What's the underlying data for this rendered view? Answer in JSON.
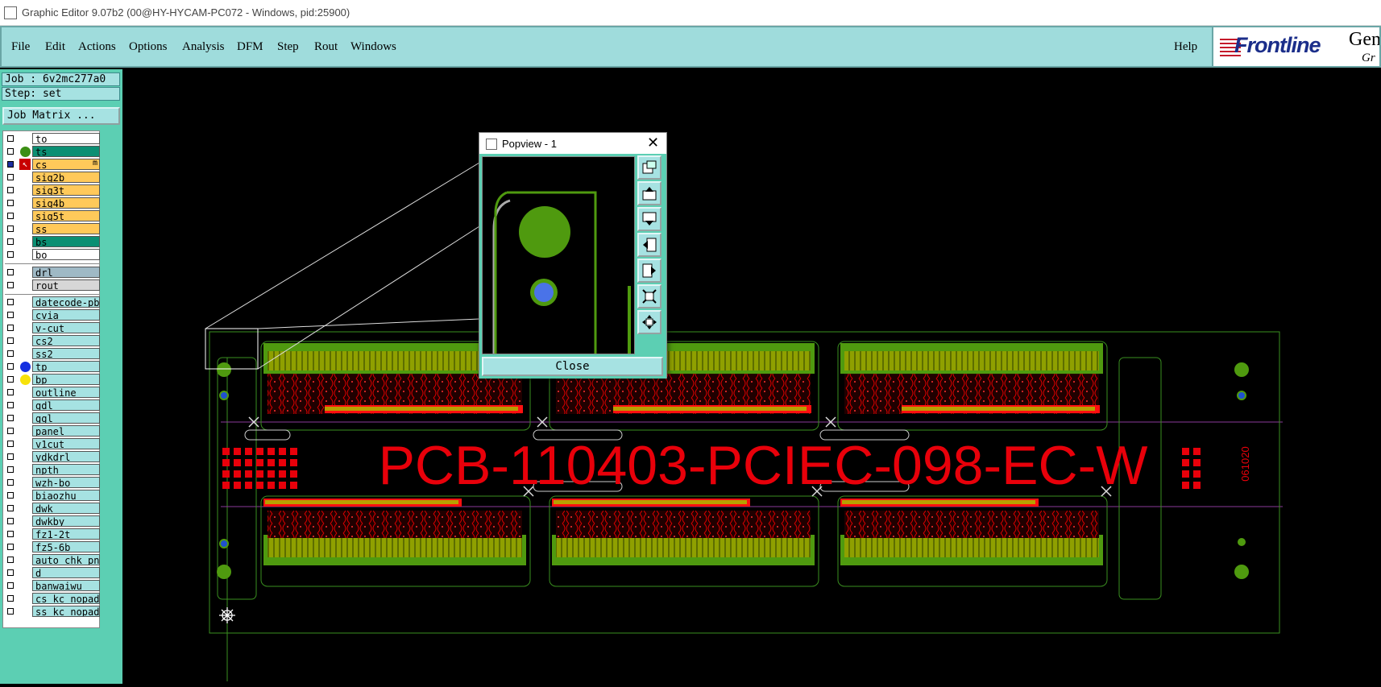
{
  "window": {
    "title": "Graphic Editor 9.07b2 (00@HY-HYCAM-PC072 - Windows, pid:25900)"
  },
  "menu": {
    "file": "File",
    "edit": "Edit",
    "actions": "Actions",
    "options": "Options",
    "analysis": "Analysis",
    "dfm": "DFM",
    "step": "Step",
    "rout": "Rout",
    "windows": "Windows",
    "help": "Help"
  },
  "logo": {
    "brand": "Frontline",
    "gen": "Gen",
    "gr": "Gr"
  },
  "job": {
    "job_label": "Job : 6v2mc277a0",
    "step_label": "Step: set",
    "matrix_button": "Job Matrix ..."
  },
  "colors": {
    "accent_bg": "#5ccfb3",
    "panel_bg": "#a6e2e2",
    "orange_layer": "#ffc95a",
    "board_layer": "#0b8f73",
    "copper_green": "#4f9a0f",
    "text_red": "#e8000a"
  },
  "layers_board": [
    {
      "name": "to",
      "bg": "#ffffff",
      "dot": ""
    },
    {
      "name": "ts",
      "bg": "#0b8f73",
      "dot": "#3c8f14"
    },
    {
      "name": "cs",
      "bg": "#ffc95a",
      "dot": "",
      "selected": true,
      "extra": "m"
    },
    {
      "name": "sig2b",
      "bg": "#ffc95a",
      "dot": ""
    },
    {
      "name": "sig3t",
      "bg": "#ffc95a",
      "dot": ""
    },
    {
      "name": "sig4b",
      "bg": "#ffc95a",
      "dot": ""
    },
    {
      "name": "sig5t",
      "bg": "#ffc95a",
      "dot": ""
    },
    {
      "name": "ss",
      "bg": "#ffc95a",
      "dot": ""
    },
    {
      "name": "bs",
      "bg": "#0b8f73",
      "dot": ""
    },
    {
      "name": "bo",
      "bg": "#ffffff",
      "dot": ""
    }
  ],
  "layers_drill": [
    {
      "name": "drl",
      "bg": "#9fb9c5",
      "dot": ""
    },
    {
      "name": "rout",
      "bg": "#d7d7d7",
      "dot": ""
    }
  ],
  "layers_misc": [
    {
      "name": "datecode-pbc",
      "bg": "#a6e2e2",
      "dot": ""
    },
    {
      "name": "cvia",
      "bg": "#a6e2e2",
      "dot": ""
    },
    {
      "name": "v-cut",
      "bg": "#a6e2e2",
      "dot": ""
    },
    {
      "name": "cs2",
      "bg": "#a6e2e2",
      "dot": ""
    },
    {
      "name": "ss2",
      "bg": "#a6e2e2",
      "dot": ""
    },
    {
      "name": "tp",
      "bg": "#a6e2e2",
      "dot": "#1530e0"
    },
    {
      "name": "bp",
      "bg": "#a6e2e2",
      "dot": "#f7e20b"
    },
    {
      "name": "outline",
      "bg": "#a6e2e2",
      "dot": ""
    },
    {
      "name": "gdl",
      "bg": "#a6e2e2",
      "dot": ""
    },
    {
      "name": "ggl",
      "bg": "#a6e2e2",
      "dot": ""
    },
    {
      "name": "panel",
      "bg": "#a6e2e2",
      "dot": ""
    },
    {
      "name": "v1cut",
      "bg": "#a6e2e2",
      "dot": ""
    },
    {
      "name": "ydkdrl",
      "bg": "#a6e2e2",
      "dot": ""
    },
    {
      "name": "npth",
      "bg": "#a6e2e2",
      "dot": ""
    },
    {
      "name": "wzh-bo",
      "bg": "#a6e2e2",
      "dot": ""
    },
    {
      "name": "biaozhu",
      "bg": "#a6e2e2",
      "dot": ""
    },
    {
      "name": "dwk",
      "bg": "#a6e2e2",
      "dot": ""
    },
    {
      "name": "dwkby",
      "bg": "#a6e2e2",
      "dot": ""
    },
    {
      "name": "fz1-2t",
      "bg": "#a6e2e2",
      "dot": ""
    },
    {
      "name": "fz5-6b",
      "bg": "#a6e2e2",
      "dot": ""
    },
    {
      "name": "auto_chk_pn",
      "bg": "#a6e2e2",
      "dot": ""
    },
    {
      "name": "d",
      "bg": "#a6e2e2",
      "dot": ""
    },
    {
      "name": "banwaiwu",
      "bg": "#a6e2e2",
      "dot": ""
    },
    {
      "name": "cs_kc_nopad",
      "bg": "#a6e2e2",
      "dot": ""
    },
    {
      "name": "ss_kc_nopad",
      "bg": "#a6e2e2",
      "dot": ""
    }
  ],
  "board": {
    "part_number": "PCB-110403-PCIEC-098-EC-W",
    "datecode": "061020"
  },
  "popview": {
    "title": "Popview - 1",
    "close_label": "Close",
    "tools": [
      "zoom-window-icon",
      "pan-up-icon",
      "pan-down-icon",
      "pan-left-icon",
      "pan-right-icon",
      "zoom-fit-icon",
      "pan-center-icon"
    ]
  }
}
